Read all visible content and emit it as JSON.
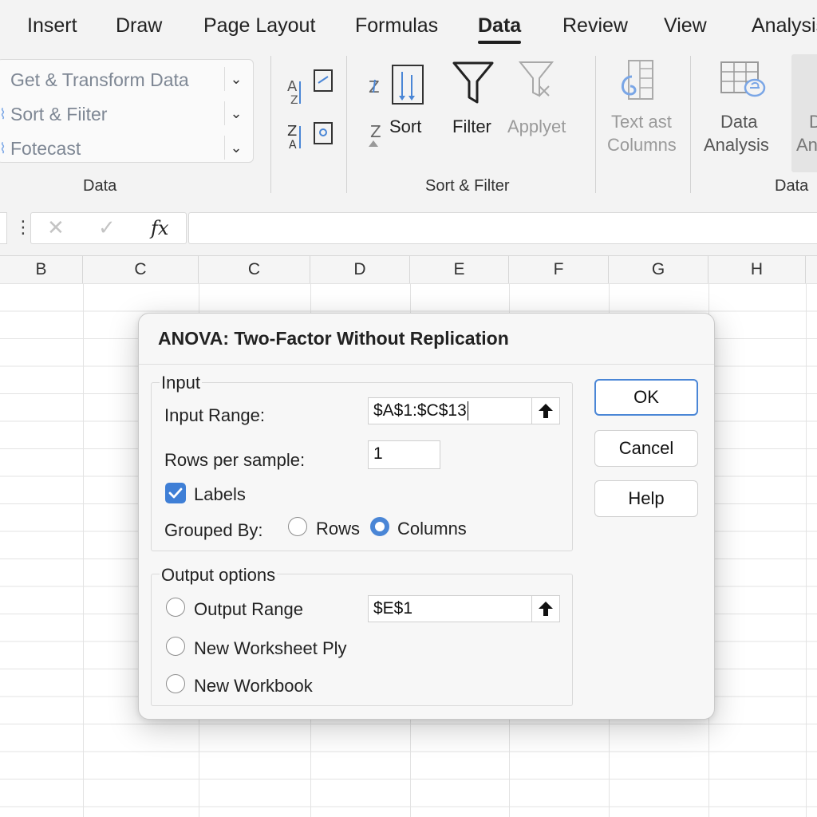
{
  "menu": {
    "items": [
      {
        "label": "Insert"
      },
      {
        "label": "Draw"
      },
      {
        "label": "Page Layout"
      },
      {
        "label": "Formulas"
      },
      {
        "label": "Data",
        "active": true
      },
      {
        "label": "Review"
      },
      {
        "label": "View"
      },
      {
        "label": "Analysis"
      }
    ]
  },
  "ribbon": {
    "query": {
      "items": [
        {
          "label": "Get & Transform Data"
        },
        {
          "label": "Sort & Fiiter"
        },
        {
          "label": "Fotecast"
        }
      ],
      "group_label": "Data"
    },
    "sort_filter": {
      "sort_label": "Sort",
      "filter_label": "Filter",
      "applyet_label": "Applyet",
      "group_label": "Sort & Filter"
    },
    "text_columns": {
      "line1": "Text ast",
      "line2": "Columns"
    },
    "data_analysis": {
      "line1": "Data",
      "line2": "Analysis"
    },
    "cut_button": {
      "line1": "D",
      "line2": "An"
    },
    "data_group_label": "Data",
    "accent_color": "#4a86d6"
  },
  "formula_bar": {
    "cancel_glyph": "✕",
    "enter_glyph": "✓",
    "fx_label": "fx",
    "more_glyph": "⋮",
    "formula_value": ""
  },
  "grid": {
    "column_headers": [
      "B",
      "C",
      "C",
      "D",
      "E",
      "F",
      "G",
      "H"
    ]
  },
  "dialog": {
    "title": "ANOVA: Two-Factor Without Replication",
    "input": {
      "legend": "Input",
      "input_range_label": "Input Range:",
      "input_range_value": "$A$1:$C$13",
      "rows_per_sample_label": "Rows per sample:",
      "rows_per_sample_value": "1",
      "labels_label": "Labels",
      "labels_checked": true,
      "grouped_by_label": "Grouped By:",
      "rows_label": "Rows",
      "columns_label": "Columns",
      "grouped_by_selected": "Columns"
    },
    "output": {
      "legend": "Output options",
      "output_range_label": "Output Range",
      "output_range_value": "$E$1",
      "new_worksheet_label": "New Worksheet Ply",
      "new_workbook_label": "New Workbook"
    },
    "buttons": {
      "ok": "OK",
      "cancel": "Cancel",
      "help": "Help"
    }
  }
}
